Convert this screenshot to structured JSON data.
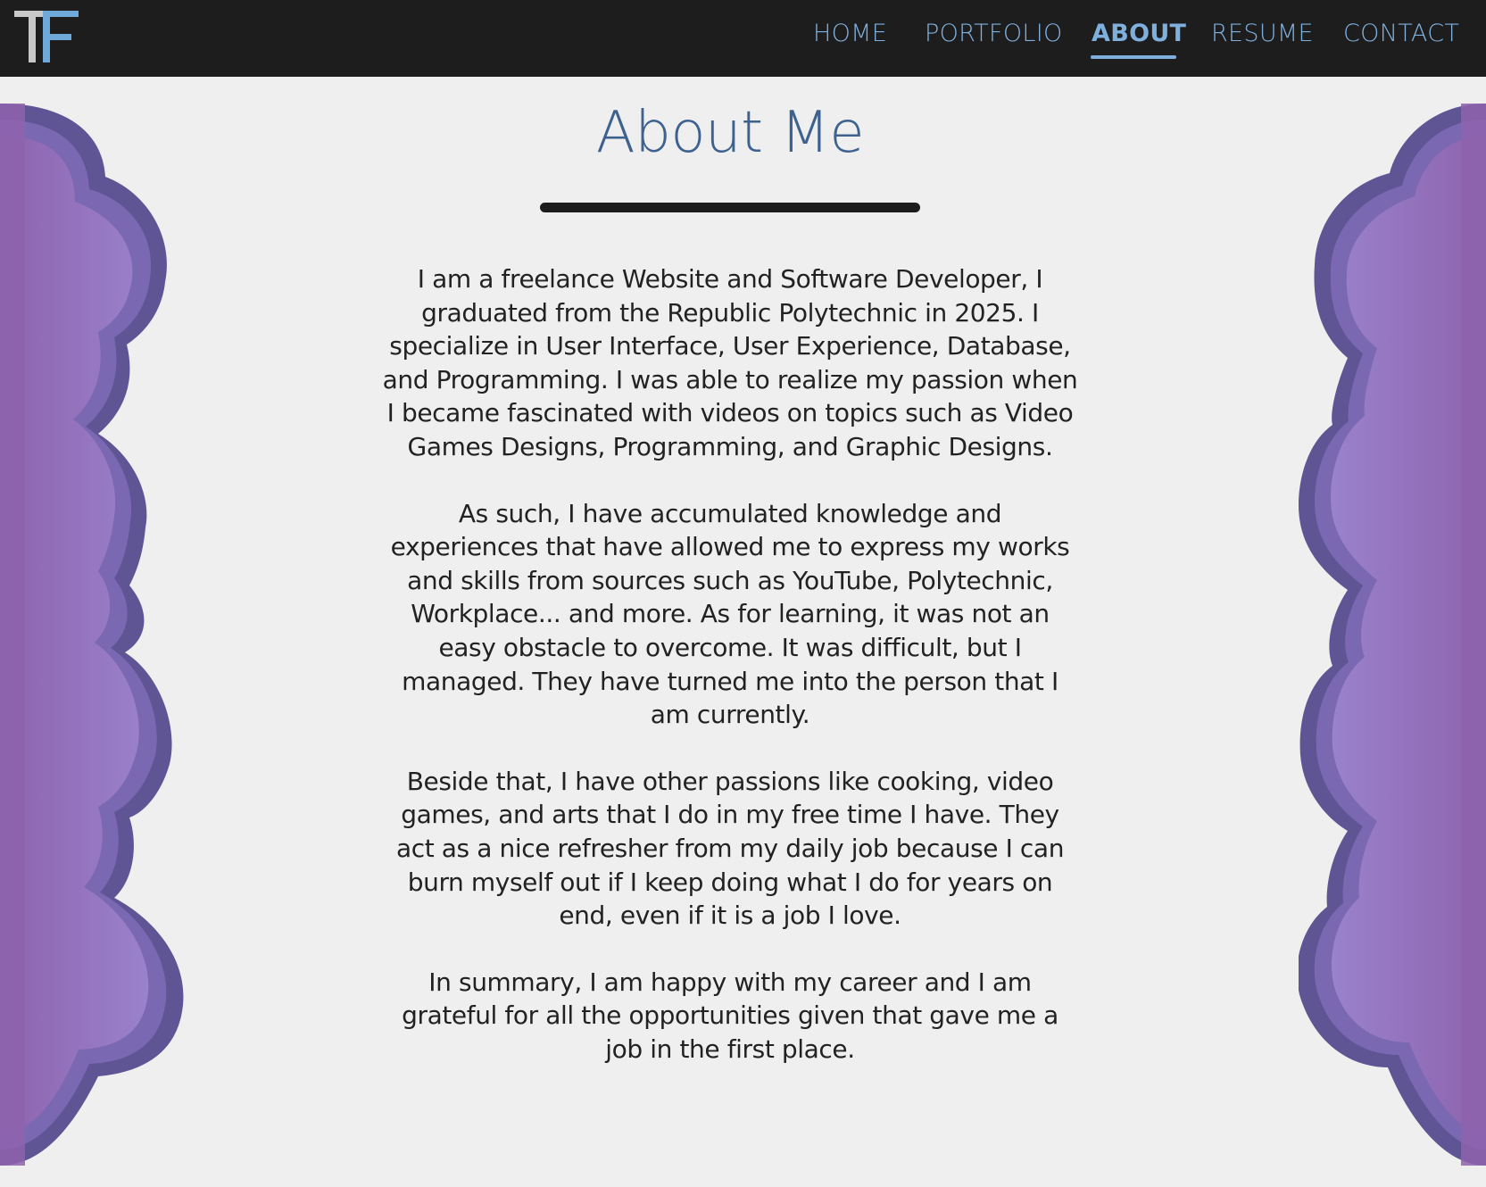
{
  "theme": {
    "navbar_bg": "#1d1d1d",
    "page_bg": "#efefef",
    "nav_link_color": "#7fb0dd",
    "title_color": "#3d628f",
    "text_color": "#222222",
    "cloud_outer": "#5f5494",
    "cloud_mid": "#7b68b2",
    "cloud_inner": "#9279c0",
    "cloud_deep": "#8e63ad"
  },
  "logo": {
    "text": "TF",
    "icon": "tf-monogram-icon",
    "color_left": "#c8c8c8",
    "color_right": "#6fa9da"
  },
  "nav": {
    "items": [
      {
        "label": "HOME",
        "active": false
      },
      {
        "label": "PORTFOLIO",
        "active": false
      },
      {
        "label": "ABOUT",
        "active": true
      },
      {
        "label": "RESUME",
        "active": false
      },
      {
        "label": "CONTACT",
        "active": false
      }
    ]
  },
  "about": {
    "title": "About Me",
    "paragraphs": [
      "I am a freelance Website and Software Developer, I graduated from the Republic Polytechnic in 2025. I specialize in User Interface, User Experience, Database, and Programming. I was able to realize my passion when I became fascinated with videos on topics such as Video Games Designs, Programming, and Graphic Designs.",
      "As such, I have accumulated knowledge and experiences that have allowed me to express my works and skills from sources such as YouTube, Polytechnic, Workplace... and more. As for learning, it was not an easy obstacle to overcome. It was difficult, but I managed. They have turned me into the person that I am currently.",
      "Beside that, I have other passions like cooking, video games, and arts that I do in my free time I have. They act as a nice refresher from my daily job because I can burn myself out if I keep doing what I do for years on end, even if it is a job I love.",
      "In summary, I am happy with my career and I am grateful for all the opportunities given that gave me a job in the first place."
    ]
  }
}
